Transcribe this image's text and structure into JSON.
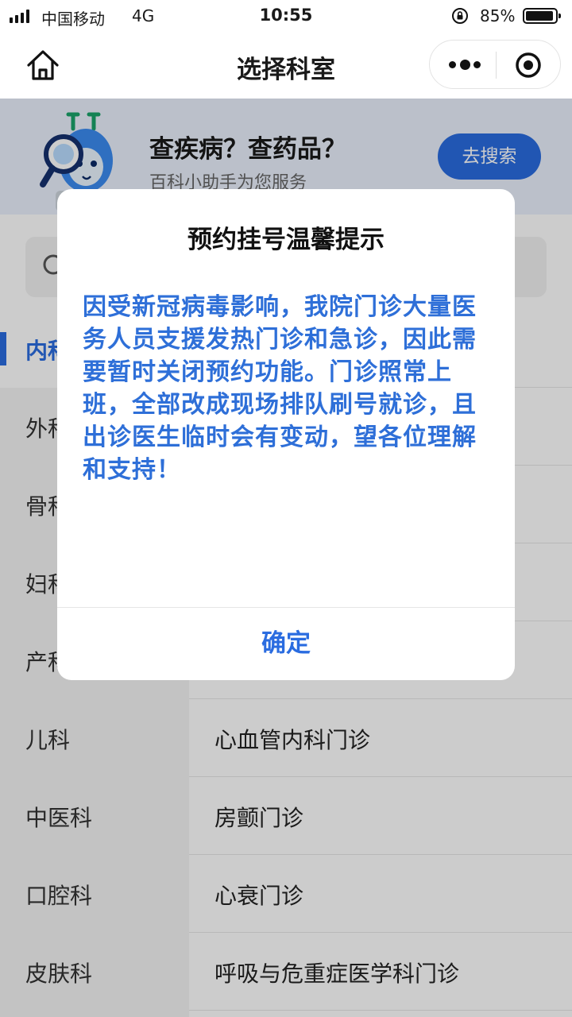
{
  "status_bar": {
    "carrier": "中国移动",
    "network": "4G",
    "time": "10:55",
    "battery_percent": "85%",
    "battery_level": 0.85,
    "icons": [
      "signal-icon",
      "orientation-lock-icon",
      "battery-icon"
    ]
  },
  "nav": {
    "title": "选择科室",
    "home_icon": "home-icon",
    "more_icon": "more-dots-icon",
    "close_icon": "target-icon"
  },
  "banner": {
    "title": "查疾病？查药品？",
    "subtitle": "百科小助手为您服务",
    "button_label": "去搜索",
    "accent_color": "#2a6ce0"
  },
  "search": {
    "icon": "search-icon"
  },
  "departments": [
    {
      "label": "内科",
      "active": true
    },
    {
      "label": "外科",
      "active": false
    },
    {
      "label": "骨科",
      "active": false
    },
    {
      "label": "妇科",
      "active": false
    },
    {
      "label": "产科",
      "active": false
    },
    {
      "label": "儿科",
      "active": false
    },
    {
      "label": "中医科",
      "active": false
    },
    {
      "label": "口腔科",
      "active": false
    },
    {
      "label": "皮肤科",
      "active": false
    }
  ],
  "clinics": [
    {
      "label": ""
    },
    {
      "label": ""
    },
    {
      "label": ""
    },
    {
      "label": ""
    },
    {
      "label": ""
    },
    {
      "label": "心血管内科门诊"
    },
    {
      "label": "房颤门诊"
    },
    {
      "label": "心衰门诊"
    },
    {
      "label": "呼吸与危重症医学科门诊"
    }
  ],
  "modal": {
    "title": "预约挂号温馨提示",
    "body": "因受新冠病毒影响，我院门诊大量医务人员支援发热门诊和急诊，因此需要暂时关闭预约功能。门诊照常上班，全部改成现场排队刷号就诊，且出诊医生临时会有变动，望各位理解和支持！",
    "confirm_label": "确定",
    "body_color": "#2e6fd8"
  }
}
